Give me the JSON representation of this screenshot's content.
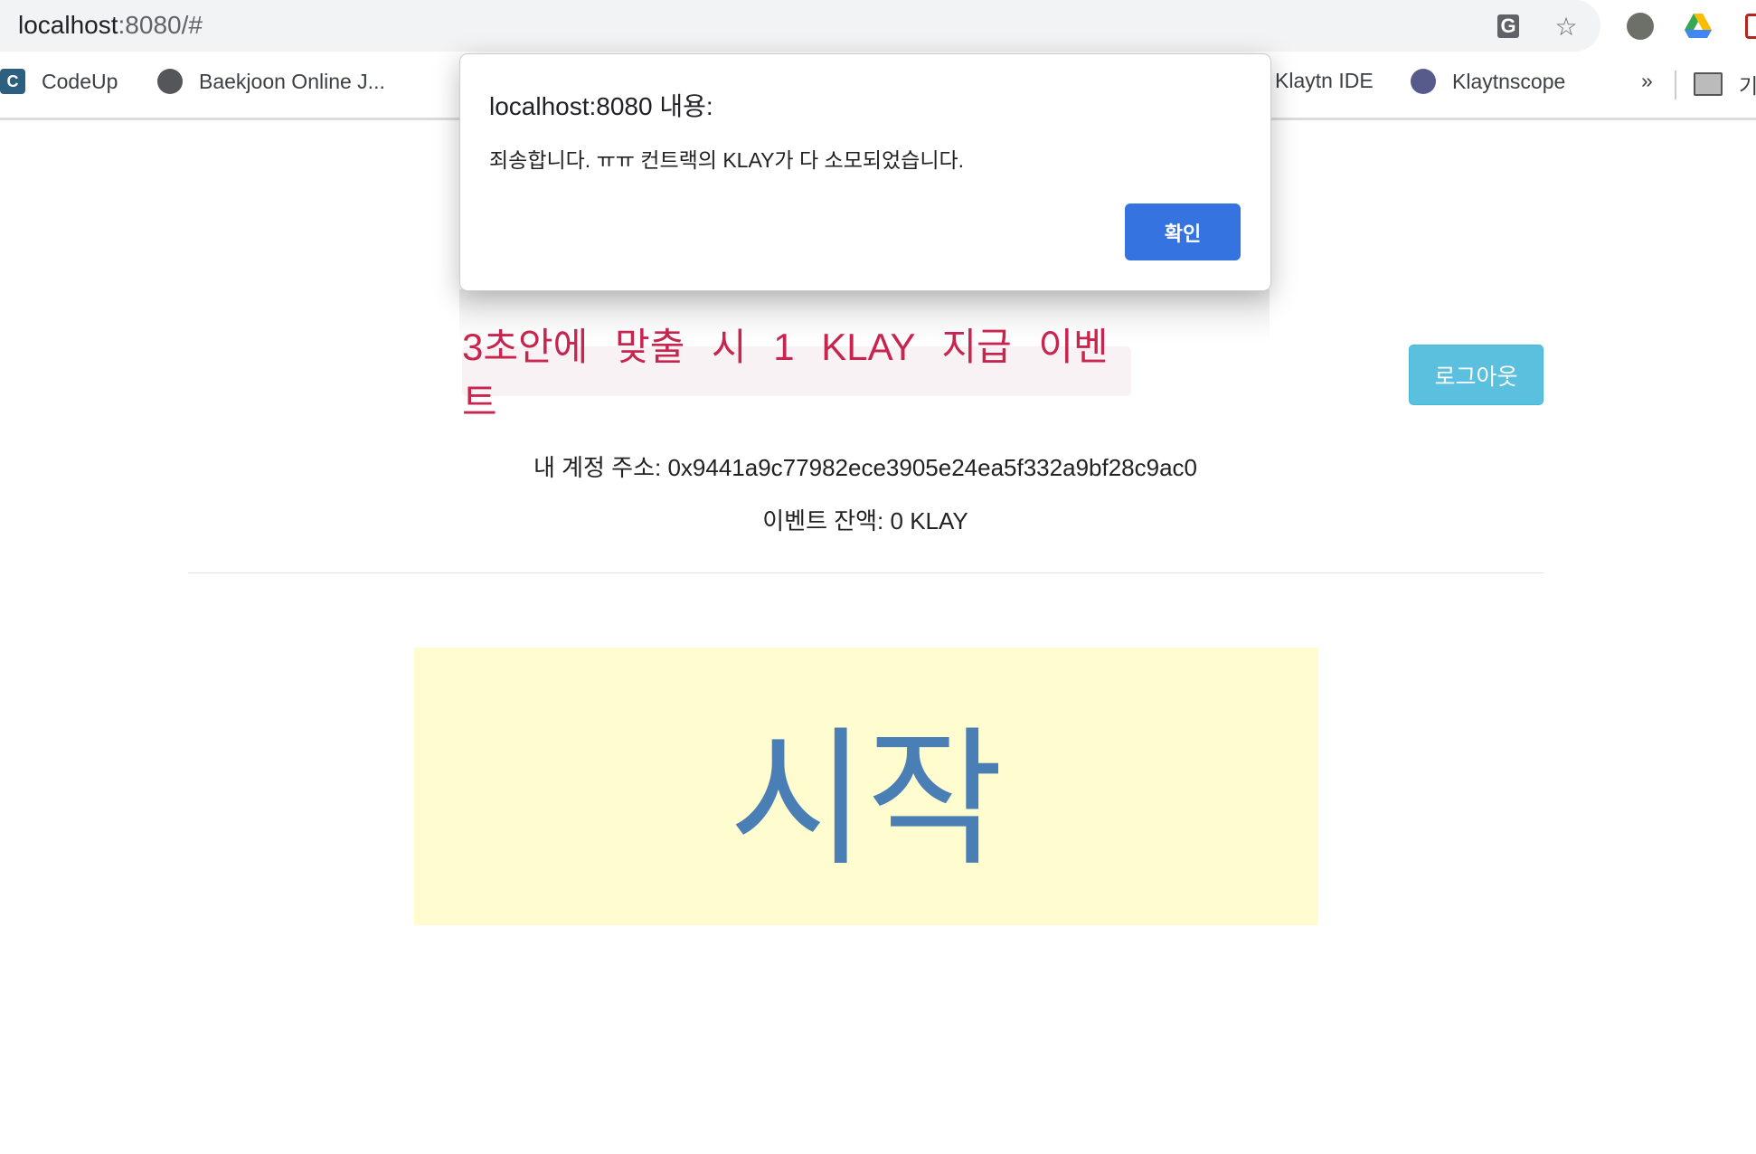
{
  "browser": {
    "url_host": "localhost",
    "url_rest": ":8080/#",
    "icons": [
      "translate-icon",
      "star-icon",
      "klaytn-extension-icon",
      "google-drive-icon",
      "record-extension-icon"
    ],
    "bookmarks": [
      {
        "label": "CodeUp",
        "icon": "codeup-icon"
      },
      {
        "label": "Baekjoon Online J...",
        "icon": "globe-icon"
      },
      {
        "label": "Klaytn IDE",
        "icon": "hummingbird-icon"
      },
      {
        "label": "Klaytnscope",
        "icon": "klaytn-icon"
      }
    ],
    "more": "»",
    "folder_label": "기"
  },
  "dialog": {
    "title": "localhost:8080 내용:",
    "message": "죄송합니다. ㅠㅠ 컨트랙의 KLAY가 다 소모되었습니다.",
    "ok_label": "확인",
    "ok_color": "#3574e0"
  },
  "page": {
    "event_banner": "3초안에 맞출 시 1 KLAY 지급 이벤트",
    "logout_label": "로그아웃",
    "account_line": "내 계정 주소: 0x9441a9c77982ece3905e24ea5f332a9bf28c9ac0",
    "balance_line": "이벤트 잔액: 0 KLAY",
    "start_label": "시작",
    "colors": {
      "event_text": "#c7254e",
      "logout_bg": "#5bc0de",
      "start_bg": "#fffccf",
      "start_text": "#4a7fb5"
    }
  }
}
